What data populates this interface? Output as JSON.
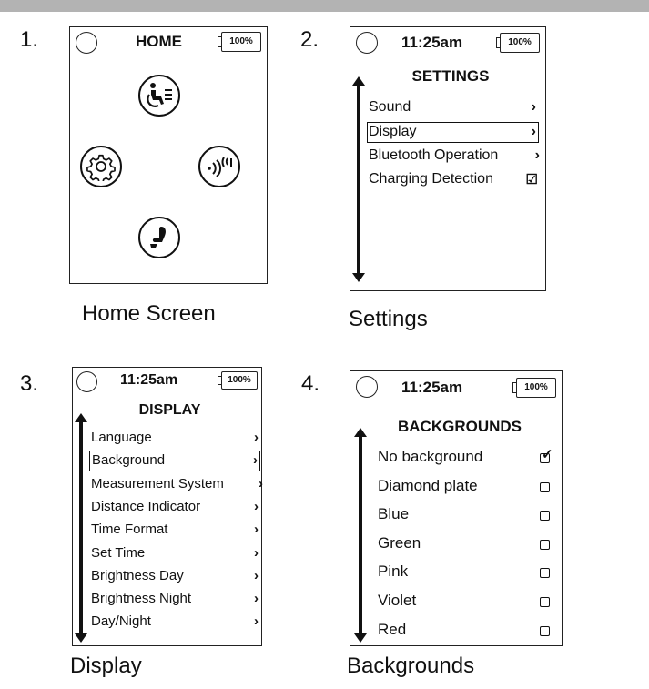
{
  "panels": [
    {
      "number": "1.",
      "caption": "Home Screen",
      "status": {
        "title": "HOME",
        "battery": "100%"
      },
      "icons": [
        "wheelchair-drive-icon",
        "settings-gear-icon",
        "wireless-connectivity-icon",
        "seating-icon"
      ]
    },
    {
      "number": "2.",
      "caption": "Settings",
      "status": {
        "title": "11:25am",
        "battery": "100%"
      },
      "heading": "SETTINGS",
      "items": [
        {
          "label": "Sound",
          "marker": "›",
          "selected": false
        },
        {
          "label": "Display",
          "marker": "›",
          "selected": true
        },
        {
          "label": "Bluetooth Operation",
          "marker": "›",
          "selected": false
        },
        {
          "label": "Charging Detection",
          "marker": "☑",
          "selected": false
        }
      ]
    },
    {
      "number": "3.",
      "caption": "Display",
      "status": {
        "title": "11:25am",
        "battery": "100%"
      },
      "heading": "DISPLAY",
      "items": [
        {
          "label": "Language",
          "selected": false
        },
        {
          "label": "Background",
          "selected": true
        },
        {
          "label": "Measurement System",
          "selected": false
        },
        {
          "label": "Distance Indicator",
          "selected": false
        },
        {
          "label": "Time Format",
          "selected": false
        },
        {
          "label": "Set Time",
          "selected": false
        },
        {
          "label": "Brightness Day",
          "selected": false
        },
        {
          "label": "Brightness Night",
          "selected": false
        },
        {
          "label": "Day/Night",
          "selected": false
        }
      ],
      "marker": "›"
    },
    {
      "number": "4.",
      "caption": "Backgrounds",
      "status": {
        "title": "11:25am",
        "battery": "100%"
      },
      "heading": "BACKGROUNDS",
      "items": [
        {
          "label": "No background",
          "checked": true
        },
        {
          "label": "Diamond plate",
          "checked": false
        },
        {
          "label": "Blue",
          "checked": false
        },
        {
          "label": "Green",
          "checked": false
        },
        {
          "label": "Pink",
          "checked": false
        },
        {
          "label": "Violet",
          "checked": false
        },
        {
          "label": "Red",
          "checked": false
        }
      ]
    }
  ]
}
